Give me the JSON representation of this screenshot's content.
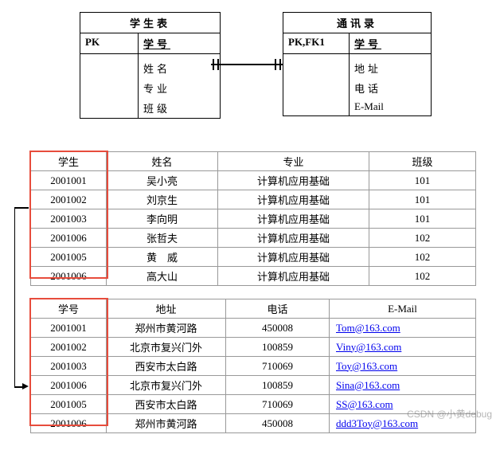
{
  "erd": {
    "left": {
      "title": "学生表",
      "pk_label": "PK",
      "pk_field": "学号",
      "attrs": [
        "姓名",
        "专业",
        "班级"
      ]
    },
    "right": {
      "title": "通讯录",
      "pk_label": "PK,FK1",
      "pk_field": "学号",
      "attrs": [
        "地址",
        "电话",
        "E-Mail"
      ]
    }
  },
  "students": {
    "headers": [
      "学生",
      "姓名",
      "专业",
      "班级"
    ],
    "rows": [
      [
        "2001001",
        "吴小亮",
        "计算机应用基础",
        "101"
      ],
      [
        "2001002",
        "刘京生",
        "计算机应用基础",
        "101"
      ],
      [
        "2001003",
        "李向明",
        "计算机应用基础",
        "101"
      ],
      [
        "2001006",
        "张哲夫",
        "计算机应用基础",
        "102"
      ],
      [
        "2001005",
        "黄　威",
        "计算机应用基础",
        "102"
      ],
      [
        "2001006",
        "高大山",
        "计算机应用基础",
        "102"
      ]
    ]
  },
  "contacts": {
    "headers": [
      "学号",
      "地址",
      "电话",
      "E-Mail"
    ],
    "rows": [
      [
        "2001001",
        "郑州市黄河路",
        "450008",
        "Tom@163.com"
      ],
      [
        "2001002",
        "北京市复兴门外",
        "100859",
        "Viny@163.com"
      ],
      [
        "2001003",
        "西安市太白路",
        "710069",
        "Toy@163.com"
      ],
      [
        "2001006",
        "北京市复兴门外",
        "100859",
        "Sina@163.com"
      ],
      [
        "2001005",
        "西安市太白路",
        "710069",
        "SS@163.com"
      ],
      [
        "2001006",
        "郑州市黄河路",
        "450008",
        "ddd3Toy@163.com"
      ]
    ]
  },
  "watermark": "CSDN @小黄debug"
}
